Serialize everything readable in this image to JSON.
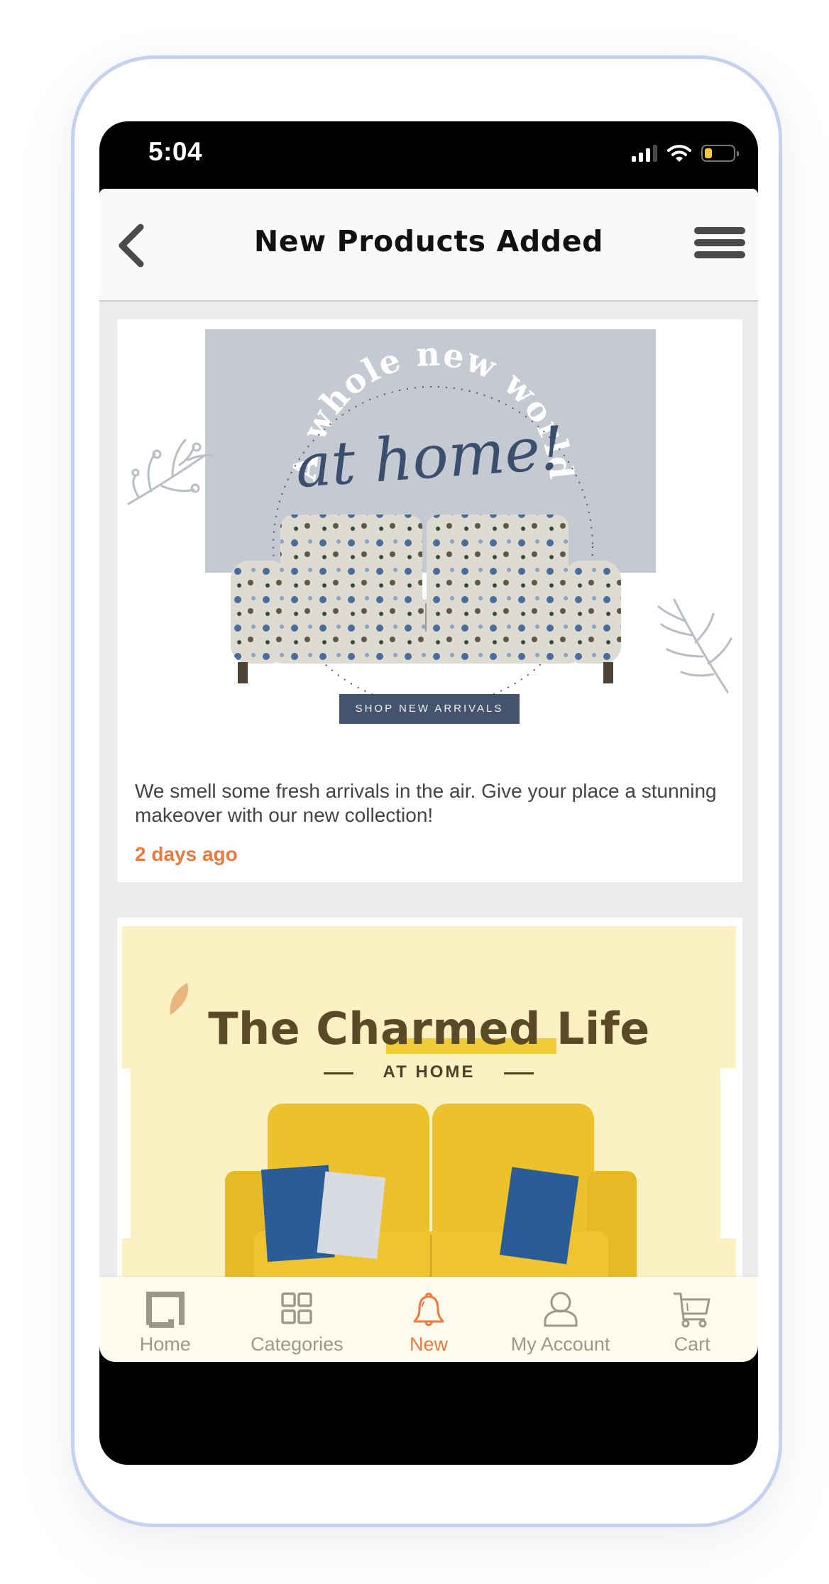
{
  "status_bar": {
    "time": "5:04",
    "signal_bars_active": 3,
    "signal_bars_total": 4,
    "battery_level": 0.25,
    "battery_color": "#f4cd35"
  },
  "header": {
    "title": "New Products Added",
    "back_icon": "chevron-left-icon",
    "menu_icon": "hamburger-menu-icon"
  },
  "feed": [
    {
      "banner": {
        "headline_arc": "A whole new world",
        "headline_script": "at home!",
        "cta": "SHOP NEW ARRIVALS",
        "cta_color": "#44536e"
      },
      "description": "We smell some fresh arrivals in the air. Give your place a stunning makeover with our new collection!",
      "time_ago": "2 days ago"
    },
    {
      "banner": {
        "headline": "The Charmed Life",
        "subheadline": "AT HOME"
      }
    }
  ],
  "bottom_nav": {
    "items": [
      {
        "label": "Home",
        "icon": "home-icon",
        "active": false
      },
      {
        "label": "Categories",
        "icon": "grid-icon",
        "active": false
      },
      {
        "label": "New",
        "icon": "bell-icon",
        "active": true
      },
      {
        "label": "My Account",
        "icon": "user-icon",
        "active": false
      },
      {
        "label": "Cart",
        "icon": "cart-icon",
        "active": false
      }
    ],
    "active_color": "#ec7a3e",
    "inactive_color": "#9c998a"
  }
}
